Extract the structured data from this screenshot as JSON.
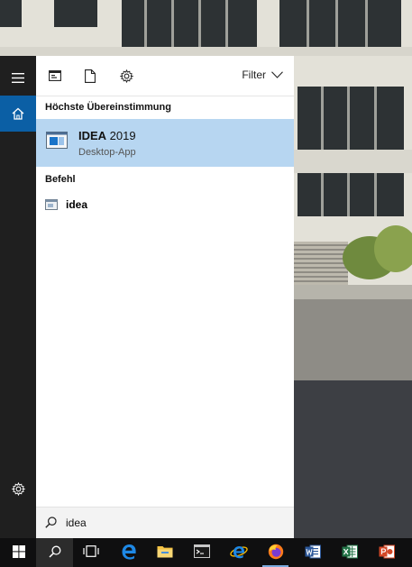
{
  "panel": {
    "filter_label": "Filter",
    "best_match_heading": "Höchste Übereinstimmung",
    "best_match": {
      "title_bold": "IDEA",
      "title_rest": " 2019",
      "subtitle": "Desktop-App"
    },
    "command_heading": "Befehl",
    "command_item": "idea"
  },
  "search": {
    "value": "idea"
  },
  "rail": {
    "items": [
      "menu-icon",
      "home-icon",
      "settings-icon"
    ]
  },
  "taskbar": {
    "items": [
      "start",
      "search",
      "task-view",
      "edge",
      "file-explorer",
      "command-prompt",
      "internet-explorer",
      "firefox",
      "word",
      "excel",
      "powerpoint"
    ]
  },
  "colors": {
    "rail": "#1f1f1f",
    "rail_active": "#0b5fa5",
    "highlight": "#b7d6f1",
    "taskbar": "#0f0f10"
  }
}
